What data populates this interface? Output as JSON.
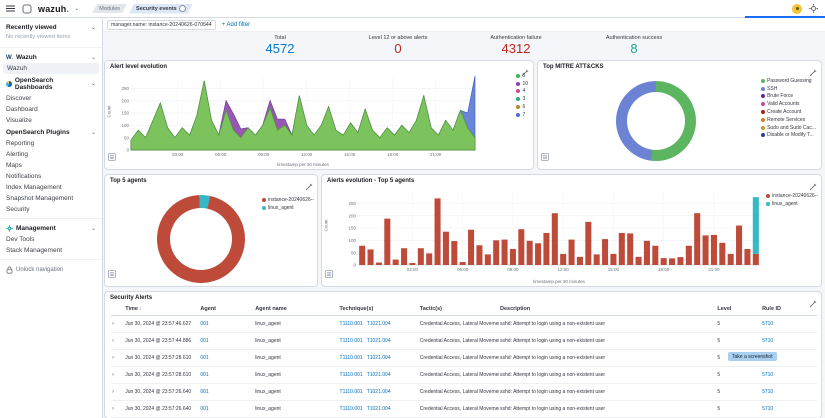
{
  "navbar": {
    "logo": "wazuh",
    "logo_dot": ".",
    "breadcrumb_modules": "Modules",
    "breadcrumb_current": "Security events"
  },
  "filter_bar": {
    "filter_pill": "manager.name: instance-20240626-070544",
    "add_filter": "+ Add filter"
  },
  "sidebar": {
    "recently_viewed_title": "Recently viewed",
    "recently_viewed_empty": "No recently viewed items",
    "wazuh_logo": "W",
    "wazuh_logo_dot": ".",
    "wazuh_title": "Wazuh",
    "wazuh_items": [
      "Wazuh"
    ],
    "dashboards_title": "OpenSearch Dashboards",
    "dashboards_items": [
      "Discover",
      "Dashboard",
      "Visualize"
    ],
    "plugins_title": "OpenSearch Plugins",
    "plugins_items": [
      "Reporting",
      "Alerting",
      "Maps",
      "Notifications",
      "Index Management",
      "Snapshot Management",
      "Security"
    ],
    "management_title": "Management",
    "management_items": [
      "Dev Tools",
      "Stack Management"
    ],
    "unlock_label": "Unlock navigation"
  },
  "stats": [
    {
      "label": "Total",
      "value": "4572",
      "color": "#0077CC"
    },
    {
      "label": "Level 12 or above alerts",
      "value": "0",
      "color": "#BD271E"
    },
    {
      "label": "Authentication failure",
      "value": "4312",
      "color": "#BD271E"
    },
    {
      "label": "Authentication success",
      "value": "8",
      "color": "#1CA88B"
    }
  ],
  "panels": {
    "alert_level": "Alert level evolution",
    "mitre": "Top MITRE ATT&CKS",
    "top_agents": "Top 5 agents",
    "alerts_evolution": "Alerts evolution - Top 5 agents",
    "security_alerts": "Security Alerts"
  },
  "chart_data": [
    {
      "id": "alert-level-evolution",
      "type": "area",
      "stacked": true,
      "title": "Alert level evolution",
      "xlabel": "timestamp per 30 minutes",
      "ylabel": "Count",
      "ylim": [
        0,
        300
      ],
      "yticks": [
        0,
        50,
        100,
        150,
        200,
        250
      ],
      "xticks": [
        "03:00",
        "06:00",
        "09:00",
        "12:00",
        "15:00",
        "18:00",
        "21:00"
      ],
      "legend": [
        {
          "label": "5",
          "color": "#3CB44A"
        },
        {
          "label": "10",
          "color": "#8E44AD"
        },
        {
          "label": "4",
          "color": "#C04A9E"
        },
        {
          "label": "3",
          "color": "#2FA87C"
        },
        {
          "label": "6",
          "color": "#B5882C"
        },
        {
          "label": "7",
          "color": "#4C6FC9"
        }
      ],
      "series": [
        {
          "name": "5",
          "color": "#4E9C35",
          "fill": "#7CC35E",
          "values": [
            40,
            80,
            50,
            120,
            190,
            90,
            50,
            90,
            60,
            140,
            280,
            120,
            60,
            160,
            80,
            50,
            90,
            60,
            100,
            170,
            80,
            100,
            60,
            220,
            100,
            60,
            100,
            175,
            80,
            60,
            110,
            70,
            165,
            80,
            50,
            90,
            60,
            100,
            70,
            120,
            220,
            90,
            60,
            120,
            80,
            160,
            90,
            50
          ]
        },
        {
          "name": "10",
          "color": "#7B3F9B",
          "fill": "#9758B4",
          "values": [
            0,
            0,
            0,
            0,
            0,
            0,
            0,
            0,
            0,
            0,
            0,
            0,
            0,
            40,
            65,
            35,
            0,
            0,
            0,
            30,
            45,
            25,
            0,
            0,
            0,
            0,
            0,
            0,
            0,
            0,
            0,
            0,
            0,
            0,
            0,
            0,
            0,
            0,
            0,
            0,
            0,
            0,
            0,
            0,
            0,
            0,
            0,
            0
          ]
        },
        {
          "name": "7",
          "color": "#4763C2",
          "fill": "#6A86D8",
          "values": [
            0,
            0,
            0,
            0,
            0,
            0,
            0,
            0,
            0,
            0,
            0,
            0,
            0,
            0,
            0,
            0,
            0,
            0,
            0,
            0,
            0,
            0,
            0,
            0,
            0,
            0,
            0,
            0,
            0,
            0,
            0,
            0,
            0,
            0,
            0,
            0,
            0,
            0,
            0,
            0,
            0,
            0,
            0,
            0,
            0,
            0,
            60,
            250
          ]
        }
      ]
    },
    {
      "id": "top-mitre-attacks",
      "type": "pie",
      "title": "Top MITRE ATT&CKS",
      "slices": [
        {
          "label": "Password Guessing",
          "value": 52,
          "color": "#5CB661"
        },
        {
          "label": "SSH",
          "value": 48,
          "color": "#6C83D4"
        },
        {
          "label": "Brute Force",
          "value": 0,
          "color": "#5B2E8E"
        },
        {
          "label": "Valid Accounts",
          "value": 0,
          "color": "#C04A9E"
        },
        {
          "label": "Create Account",
          "value": 0,
          "color": "#A32424"
        },
        {
          "label": "Remote Services",
          "value": 0,
          "color": "#D47E28"
        },
        {
          "label": "Sudo and Sudo Cac...",
          "value": 0,
          "color": "#C2A02E"
        },
        {
          "label": "Disable or Modify T...",
          "value": 0,
          "color": "#2E3FA3"
        }
      ]
    },
    {
      "id": "top-5-agents",
      "type": "pie",
      "title": "Top 5 agents",
      "slices": [
        {
          "label": "instance-20240626--",
          "value": 96,
          "color": "#BE4A39"
        },
        {
          "label": "linux_agent",
          "value": 4,
          "color": "#35B9C6"
        }
      ]
    },
    {
      "id": "alerts-evolution-top-5-agents",
      "type": "bar",
      "stacked": true,
      "title": "Alerts evolution - Top 5 agents",
      "xlabel": "timestamp per 30 minutes",
      "ylabel": "Count",
      "ylim": [
        0,
        300
      ],
      "yticks": [
        0,
        50,
        100,
        150,
        200,
        250
      ],
      "xticks": [
        "03:00",
        "06:00",
        "09:00",
        "12:00",
        "15:00",
        "18:00",
        "21:00"
      ],
      "series": [
        {
          "name": "instance-20240626--",
          "color": "#BE4A39",
          "values": [
            78,
            63,
            10,
            188,
            22,
            68,
            8,
            68,
            47,
            270,
            135,
            97,
            12,
            143,
            80,
            43,
            100,
            103,
            65,
            145,
            98,
            88,
            130,
            210,
            45,
            103,
            33,
            175,
            43,
            105,
            45,
            130,
            128,
            33,
            98,
            78,
            28,
            27,
            32,
            78,
            210,
            120,
            122,
            90,
            45,
            160,
            65,
            45
          ]
        },
        {
          "name": "linux_agent",
          "color": "#35B9C6",
          "values": [
            0,
            0,
            0,
            0,
            0,
            0,
            0,
            0,
            0,
            0,
            0,
            0,
            0,
            0,
            0,
            0,
            0,
            0,
            0,
            0,
            0,
            0,
            0,
            0,
            0,
            0,
            0,
            0,
            0,
            0,
            0,
            0,
            0,
            0,
            0,
            0,
            0,
            0,
            0,
            0,
            0,
            0,
            0,
            0,
            0,
            0,
            0,
            230
          ]
        }
      ]
    }
  ],
  "table": {
    "columns": [
      "Time",
      "Agent",
      "Agent name",
      "Technique(s)",
      "Tactic(s)",
      "Description",
      "Level",
      "Rule ID"
    ],
    "rows": [
      {
        "time": "Jun 30, 2024 @ 23:57:46.627",
        "agent": "001",
        "agent_name": "linux_agent",
        "techniques": [
          "T1110.001",
          "T1021.004"
        ],
        "tactics": "Credential Access, Lateral Movement",
        "description": "sshd: Attempt to login using a non-existent user",
        "level": "5",
        "rule_id": "5710"
      },
      {
        "time": "Jun 30, 2024 @ 23:57:44.886",
        "agent": "001",
        "agent_name": "linux_agent",
        "techniques": [
          "T1110.001",
          "T1021.004"
        ],
        "tactics": "Credential Access, Lateral Movement",
        "description": "sshd: Attempt to login using a non-existent user",
        "level": "5",
        "rule_id": "5710"
      },
      {
        "time": "Jun 30, 2024 @ 23:57:28.610",
        "agent": "001",
        "agent_name": "linux_agent",
        "techniques": [
          "T1110.001",
          "T1021.004"
        ],
        "tactics": "Credential Access, Lateral Movement",
        "description": "sshd: Attempt to login using a non-existent user",
        "level": "5",
        "rule_id": "5710"
      },
      {
        "time": "Jun 30, 2024 @ 23:57:28.610",
        "agent": "001",
        "agent_name": "linux_agent",
        "techniques": [
          "T1110.001",
          "T1021.004"
        ],
        "tactics": "Credential Access, Lateral Movement",
        "description": "sshd: Attempt to login using a non-existent user",
        "level": "5",
        "rule_id": "5710"
      },
      {
        "time": "Jun 30, 2024 @ 23:57:26.640",
        "agent": "001",
        "agent_name": "linux_agent",
        "techniques": [
          "T1110.001",
          "T1021.004"
        ],
        "tactics": "Credential Access, Lateral Movement",
        "description": "sshd: Attempt to login using a non-existent user",
        "level": "5",
        "rule_id": "5710"
      },
      {
        "time": "Jun 30, 2024 @ 23:57:26.640",
        "agent": "001",
        "agent_name": "linux_agent",
        "techniques": [
          "T1110.001",
          "T1021.004"
        ],
        "tactics": "Credential Access, Lateral Movement",
        "description": "sshd: Attempt to login using a non-existent user",
        "level": "5",
        "rule_id": "5710"
      }
    ]
  },
  "overlay": {
    "screenshot_button": "Take a screenshot"
  }
}
